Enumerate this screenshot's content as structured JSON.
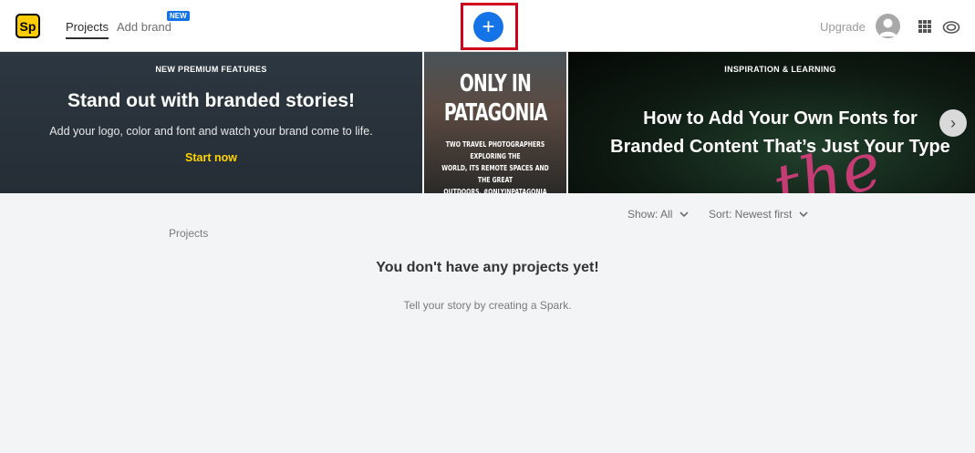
{
  "header": {
    "logo_text": "Sp",
    "nav": {
      "projects": "Projects",
      "add_brand": "Add brand",
      "new_badge": "NEW"
    },
    "create_symbol": "+",
    "upgrade": "Upgrade",
    "icons": [
      "avatar-icon",
      "apps-grid-icon",
      "creative-cloud-icon"
    ]
  },
  "banners": {
    "branded": {
      "kicker": "NEW PREMIUM FEATURES",
      "title": "Stand out with branded stories!",
      "subtitle": "Add your logo, color and font and watch your brand come to life.",
      "cta": "Start now"
    },
    "patagonia": {
      "line1": "ONLY IN",
      "line2": "PATAGONIA",
      "small1": "TWO TRAVEL PHOTOGRAPHERS EXPLORING THE",
      "small2": "WORLD, ITS REMOTE SPACES AND THE GREAT",
      "small3": "OUTDOORS. #ONLYINPATAGONIA"
    },
    "fonts": {
      "kicker": "INSPIRATION & LEARNING",
      "title_line1": "How to Add Your Own Fonts for",
      "title_line2": "Branded Content That’s Just Your Type",
      "neon_text": "the"
    },
    "next_symbol": "›"
  },
  "toolbar": {
    "show": "Show: All",
    "sort": "Sort: Newest first"
  },
  "main": {
    "section_label": "Projects",
    "empty_title": "You don't have any projects yet!",
    "empty_subtitle": "Tell your story by creating a Spark."
  },
  "colors": {
    "accent": "#1473e6",
    "highlight": "#d0021b",
    "cta": "#ffd400",
    "logo": "#fecc00"
  }
}
